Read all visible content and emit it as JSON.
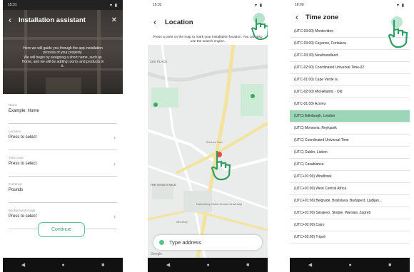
{
  "accent_color": "#5bc28f",
  "screen1": {
    "status_time": "15:31",
    "status_icons": "▾ ▮",
    "title": "Installation assistant",
    "back_icon": "chevron-left-icon",
    "close_icon": "close-icon",
    "intro_lines": [
      "Here we will guide you through the app installation",
      "process of your property.",
      "We will begin by assigning a short name, such as",
      "Home, and we will be adding rooms and products in",
      "it."
    ],
    "fields": [
      {
        "label": "Name",
        "value": "Example: Home",
        "has_chevron": false
      },
      {
        "label": "Location",
        "value": "Press to select",
        "has_chevron": true
      },
      {
        "label": "Time zone",
        "value": "Press to select",
        "has_chevron": true
      },
      {
        "label": "Currency",
        "value": "Pounds",
        "has_chevron": false
      },
      {
        "label": "Background image",
        "value": "Press to select",
        "has_chevron": true
      }
    ],
    "continue_label": "Continue"
  },
  "screen2": {
    "status_time": "15:32",
    "title": "Location",
    "instructions": "Press a point on the map to mark your installation location. You can also use the search engine.",
    "map_labels": [
      "LES PLACE",
      "THE KING'S MILE",
      "Canterbury Christ Church University",
      "Rhodaus Town",
      "Wincheap"
    ],
    "search_placeholder": "Type address",
    "google_label": "Google"
  },
  "screen3": {
    "status_time": "18:00",
    "title": "Time zone",
    "selected_index": 7,
    "zones": [
      "(UTC-03:00) Montevideo",
      "(UTC-03:00) Cayenne, Fortaleza",
      "(UTC-03:30) Newfoundland",
      "(UTC-02:00) Coordinated Universal Time-02",
      "(UTC-01:00) Cape Verde Is.",
      "(UTC-02:00) Mid-Atlantic - Old",
      "(UTC-01:00) Azores",
      "(UTC) Edinburgh, London",
      "(UTC) Monrovia, Reykjavik",
      "(UTC) Coordinated Universal Time",
      "(UTC) Dublin, Lisbon",
      "(UTC) Casablanca",
      "(UTC+01:00) Windhoek",
      "(UTC+01:00) West Central Africa",
      "(UTC+01:00) Belgrade, Bratislava, Budapest, Ljubljan...",
      "(UTC+01:00) Sarajevo, Skopje, Warsaw, Zagreb",
      "(UTC+02:00) Cairo",
      "(UTC+02:00) Tripoli"
    ]
  },
  "navbar": {
    "back": "◀",
    "home": "●",
    "recent": "■"
  }
}
